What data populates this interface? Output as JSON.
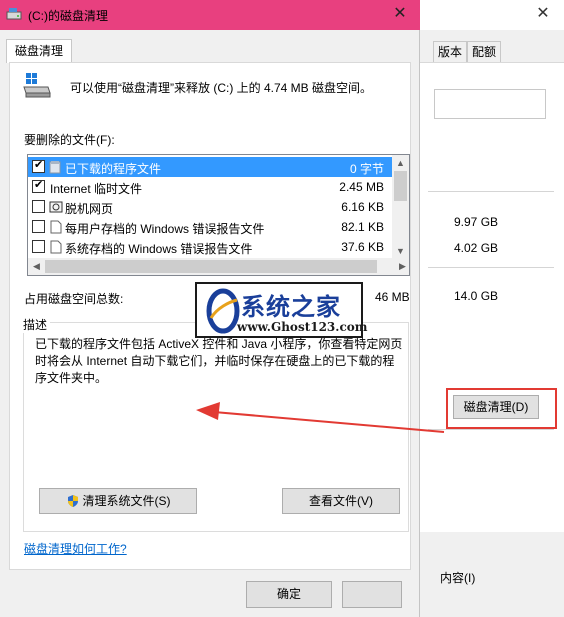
{
  "background_window": {
    "tabs": [
      "版本",
      "配额"
    ],
    "sizes": [
      "9.97 GB",
      "4.02 GB",
      "14.0 GB"
    ],
    "cleanup_button": "磁盘清理(D)",
    "checkbox_text": "内容(I)"
  },
  "dialog": {
    "title": "(C:)的磁盘清理",
    "tab": "磁盘清理",
    "summary": "可以使用“磁盘清理”来释放  (C:) 上的 4.74 MB 磁盘空间。",
    "files_label": "要删除的文件(F):",
    "files": [
      {
        "name": "已下载的程序文件",
        "size": "0 字节",
        "checked": true,
        "selected": true
      },
      {
        "name": "Internet 临时文件",
        "size": "2.45 MB",
        "checked": true,
        "selected": false
      },
      {
        "name": "脱机网页",
        "size": "6.16 KB",
        "checked": false,
        "selected": false
      },
      {
        "name": "每用户存档的 Windows 错误报告文件",
        "size": "82.1 KB",
        "checked": false,
        "selected": false
      },
      {
        "name": "系统存档的 Windows 错误报告文件",
        "size": "37.6 KB",
        "checked": false,
        "selected": false
      }
    ],
    "space_label": "占用磁盘空间总数:",
    "space_value": "46 MB",
    "description_title": "描述",
    "description_text": "已下载的程序文件包括 ActiveX 控件和 Java 小程序，你查看特定网页时将会从 Internet 自动下载它们，并临时保存在硬盘上的已下载的程序文件夹中。",
    "clean_system_button": "清理系统文件(S)",
    "view_files_button": "查看文件(V)",
    "help_link": "磁盘清理如何工作?",
    "ok_button": "确定"
  },
  "watermark": {
    "text": "系统之家",
    "url": "www.Ghost123.com"
  },
  "colors": {
    "titlebar": "#e8407f",
    "selection": "#3399ff",
    "arrow": "#e23a33",
    "link": "#0066cc"
  }
}
